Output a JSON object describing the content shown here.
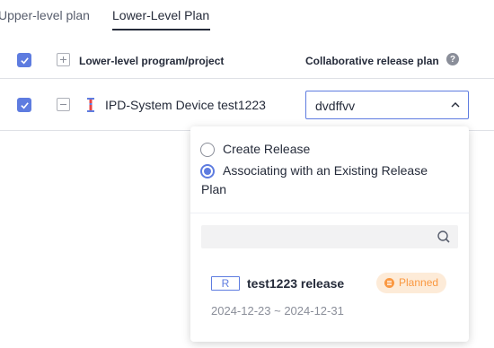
{
  "tabs": [
    {
      "label": "Upper-level plan"
    },
    {
      "label": "Lower-Level Plan"
    }
  ],
  "table": {
    "col_project": "Lower-level program/project",
    "col_release": "Collaborative release plan",
    "help_glyph": "?"
  },
  "row": {
    "project_name": "IPD-System Device test1223",
    "selected_release": "dvdffvv"
  },
  "dropdown": {
    "option_create": "Create Release",
    "option_associate": "Associating with an Existing Release Plan",
    "search_placeholder": "",
    "release": {
      "type_badge": "R",
      "name": "test1223 release",
      "status": "Planned",
      "dates": "2024-12-23 ~ 2024-12-31"
    }
  },
  "colors": {
    "accent": "#5e7ce0",
    "status_planned": "#fa9841",
    "status_planned_bg": "#fdebd8"
  },
  "icons": [
    "check-icon",
    "expand-plus-icon",
    "collapse-minus-icon",
    "help-icon",
    "project-icon",
    "chevron-up-icon",
    "search-icon",
    "planned-status-icon"
  ]
}
